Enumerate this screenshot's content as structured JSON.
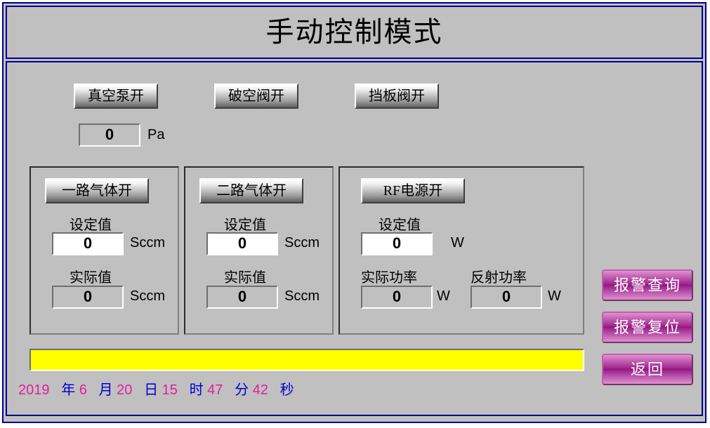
{
  "title": "手动控制模式",
  "top_buttons": {
    "vacuum_pump": "真空泵开",
    "vent_valve": "破空阀开",
    "baffle_valve": "挡板阀开"
  },
  "pressure": {
    "value": "0",
    "unit": "Pa"
  },
  "gas1": {
    "button": "一路气体开",
    "set_label": "设定值",
    "set_value": "0",
    "set_unit": "Sccm",
    "act_label": "实际值",
    "act_value": "0",
    "act_unit": "Sccm"
  },
  "gas2": {
    "button": "二路气体开",
    "set_label": "设定值",
    "set_value": "0",
    "set_unit": "Sccm",
    "act_label": "实际值",
    "act_value": "0",
    "act_unit": "Sccm"
  },
  "rf": {
    "button": "RF电源开",
    "set_label": "设定值",
    "set_value": "0",
    "set_unit": "W",
    "actual_label": "实际功率",
    "actual_value": "0",
    "actual_unit": "W",
    "reflect_label": "反射功率",
    "reflect_value": "0",
    "reflect_unit": "W"
  },
  "side": {
    "alarm_query": "报警查询",
    "alarm_reset": "报警复位",
    "back": "返回"
  },
  "status_bar": "",
  "datetime": {
    "year": "2019",
    "y_lbl": "年",
    "month": "6",
    "mo_lbl": "月",
    "day": "20",
    "d_lbl": "日",
    "hour": "15",
    "h_lbl": "时",
    "min": "47",
    "mi_lbl": "分",
    "sec": "42",
    "s_lbl": "秒"
  }
}
